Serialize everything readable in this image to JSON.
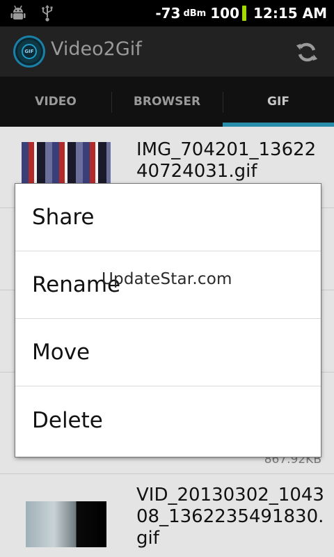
{
  "status_bar": {
    "left_icons": [
      "android-debug-icon",
      "usb-icon"
    ],
    "signal": "-73",
    "signal_unit": "dBm",
    "battery": "100",
    "time": "12:15 AM"
  },
  "app": {
    "title": "Video2Gif",
    "logo_text": "GIF"
  },
  "tabs": [
    {
      "label": "VIDEO",
      "selected": false
    },
    {
      "label": "BROWSER",
      "selected": false
    },
    {
      "label": "GIF",
      "selected": true
    }
  ],
  "list": [
    {
      "name": "IMG_704201_1362240724031.gif",
      "size": ""
    },
    {
      "name": "",
      "size": "867.92KB"
    },
    {
      "name": "VID_20130302_104308_1362235491830.gif",
      "size": ""
    }
  ],
  "menu": {
    "items": [
      "Share",
      "Rename",
      "Move",
      "Delete"
    ]
  },
  "watermark": "UpdateStar.com",
  "colors": {
    "accent": "#2a8eaa",
    "battery": "#a3d800"
  }
}
